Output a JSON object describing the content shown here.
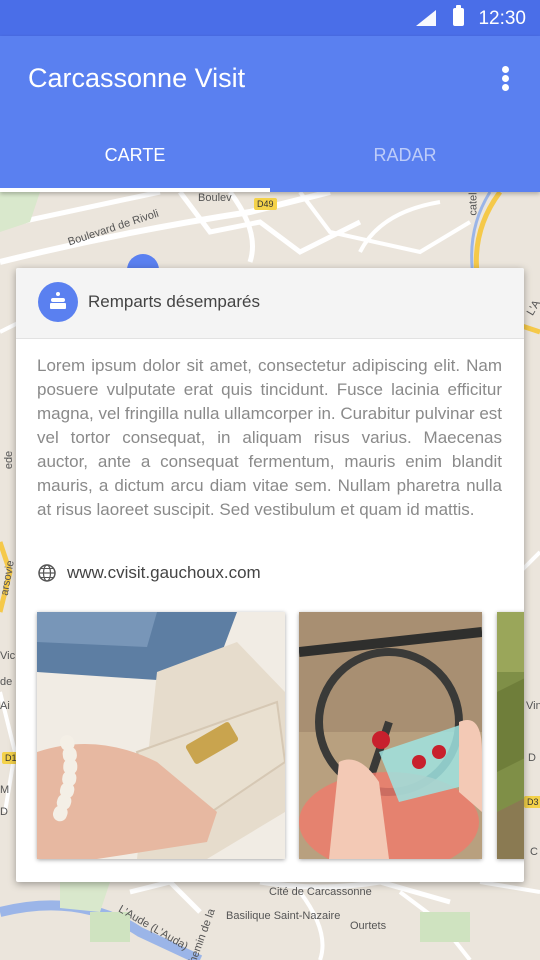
{
  "status_bar": {
    "time": "12:30",
    "signal_icon": "signal-icon",
    "battery_icon": "battery-icon"
  },
  "app_bar": {
    "title": "Carcassonne Visit",
    "menu_icon": "more-vert-icon",
    "color": "#5a80f0"
  },
  "tabs": [
    {
      "label": "CARTE",
      "active": true
    },
    {
      "label": "RADAR",
      "active": false
    }
  ],
  "map": {
    "labels": {
      "boulevard_rivoli": "Boulevard de Rivoli",
      "boulev": "Boulev",
      "road_d49": "D49",
      "catel": "catel",
      "cite": "Cité de Carcassonne",
      "basilique": "Basilique Saint-Nazaire",
      "aude": "L'Aude (L'Auda)",
      "ourtets": "Ourtets",
      "chemin": "hemin de la",
      "road_d1": "D1",
      "road_d3": "D3",
      "right_l": "L'A",
      "left_labels": [
        "ede",
        "arsovie",
        "Vic",
        "de",
        "Ai",
        "D1",
        "M",
        "D"
      ],
      "right_labels": [
        "Vin",
        "D",
        "D3",
        "C"
      ]
    }
  },
  "card": {
    "icon": "cake-icon",
    "place_name": "Remparts désemparés",
    "description": "Lorem ipsum dolor sit amet, consectetur adipiscing elit. Nam posuere vulputate erat quis tincidunt. Fusce lacinia efficitur magna, vel fringilla nulla ullamcorper in. Curabitur pulvinar est vel tortor consequat, in aliquam risus varius. Maecenas auctor, ante a consequat fermentum, mauris enim blandit mauris, a dictum arcu diam vitae sem. Nullam pharetra nulla at risus laoreet suscipit. Sed vestibulum et quam id mattis.",
    "link_icon": "globe-icon",
    "link": "www.cvisit.gauchoux.com",
    "photos": [
      "photo-handbag",
      "photo-raspberries",
      "photo-grass"
    ]
  }
}
